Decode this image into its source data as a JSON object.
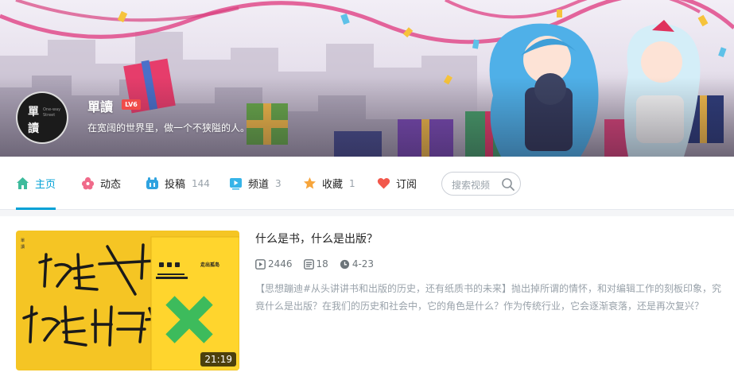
{
  "profile": {
    "name": "單讀",
    "level": "LV6",
    "signature": "在宽阔的世界里，做一个不狭隘的人。",
    "avatar_text": [
      "單",
      "讀"
    ],
    "avatar_small_text": [
      "One-way",
      "Street"
    ]
  },
  "nav": {
    "tabs": [
      {
        "label": "主页",
        "count": "",
        "icon": "home-icon",
        "active": true
      },
      {
        "label": "动态",
        "count": "",
        "icon": "feed-icon",
        "active": false
      },
      {
        "label": "投稿",
        "count": "144",
        "icon": "upload-icon",
        "active": false
      },
      {
        "label": "频道",
        "count": "3",
        "icon": "channel-icon",
        "active": false
      },
      {
        "label": "收藏",
        "count": "1",
        "icon": "star-icon",
        "active": false
      },
      {
        "label": "订阅",
        "count": "",
        "icon": "heart-icon",
        "active": false
      }
    ],
    "search_placeholder": "搜索视频"
  },
  "video": {
    "title": "什么是书，什么是出版？",
    "duration": "21:19",
    "plays": "2446",
    "danmaku": "18",
    "date": "4-23",
    "description": "【思想蹦迪#从头讲讲书和出版的历史，还有纸质书的未来】抛出掉所谓的情怀，和对编辑工作的刻板印象，究竟什么是出版？在我们的历史和社会中，它的角色是什么？作为传统行业，它会逐渐衰落，还是再次复兴？",
    "thumb_small_text": [
      "單",
      "讀"
    ],
    "book_title": "走出孤岛"
  },
  "colors": {
    "accent": "#00a1d6",
    "level_badge": "#f04c49",
    "thumbnail_bg": "#f5c524",
    "book_cover": "#ffd52d",
    "cross": "#3dbb5c"
  }
}
